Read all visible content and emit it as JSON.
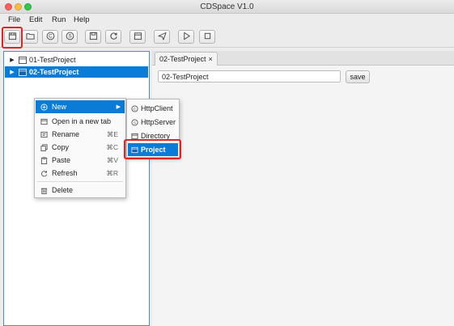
{
  "window": {
    "title": "CDSpace V1.0"
  },
  "menubar": [
    "File",
    "Edit",
    "Run",
    "Help"
  ],
  "toolbar": {
    "buttons": [
      {
        "name": "new-project-icon"
      },
      {
        "name": "open-folder-icon"
      },
      {
        "name": "client-icon"
      },
      {
        "name": "server-icon"
      },
      {
        "name": "save-icon"
      },
      {
        "name": "refresh-icon"
      },
      {
        "name": "window-icon"
      },
      {
        "name": "send-icon"
      },
      {
        "name": "run-icon"
      },
      {
        "name": "stop-icon"
      }
    ]
  },
  "tree": {
    "items": [
      {
        "label": "01-TestProject",
        "selected": false
      },
      {
        "label": "02-TestProject",
        "selected": true
      }
    ]
  },
  "editor": {
    "tab_label": "02-TestProject",
    "tab_close": "×",
    "name_value": "02-TestProject",
    "save_label": "save"
  },
  "context_menu": {
    "items": [
      {
        "label": "New",
        "shortcut": "",
        "submenu": true,
        "active": true,
        "icon": "plus-circle-icon"
      },
      {
        "label": "Open in a new tab",
        "shortcut": "",
        "icon": "window-icon"
      },
      {
        "label": "Rename",
        "shortcut": "⌘E",
        "icon": "rename-icon"
      },
      {
        "label": "Copy",
        "shortcut": "⌘C",
        "icon": "copy-icon"
      },
      {
        "label": "Paste",
        "shortcut": "⌘V",
        "icon": "paste-icon"
      },
      {
        "label": "Refresh",
        "shortcut": "⌘R",
        "icon": "refresh-icon"
      },
      {
        "label": "Delete",
        "shortcut": "",
        "icon": "trash-icon"
      }
    ]
  },
  "submenu": {
    "items": [
      {
        "label": "HttpClient",
        "icon": "client-icon",
        "active": false
      },
      {
        "label": "HttpServer",
        "icon": "server-icon",
        "active": false
      },
      {
        "label": "Directory",
        "icon": "folder-icon",
        "active": false
      },
      {
        "label": "Project",
        "icon": "project-icon",
        "active": true
      }
    ]
  },
  "colors": {
    "selection": "#0a7bd6",
    "highlight": "#e02424",
    "panel_border": "#3d8ee0"
  }
}
